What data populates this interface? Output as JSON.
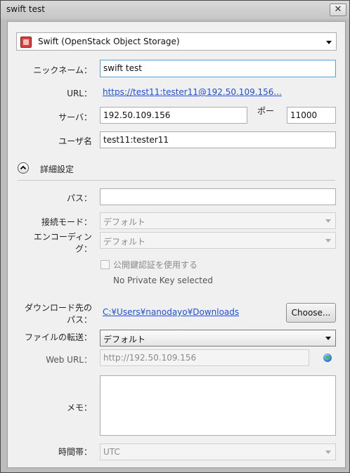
{
  "window": {
    "title": "swift test",
    "close_symbol": "✕"
  },
  "service": {
    "selected": "Swift (OpenStack Object Storage)"
  },
  "form": {
    "nickname_label": "ニックネーム：",
    "nickname_value": "swift test",
    "url_label": "URL：",
    "url_value": "https://test11:tester11@192.50.109.156...",
    "server_label": "サーバ：",
    "server_value": "192.50.109.156",
    "port_label": "ポー",
    "port_value": "11000",
    "user_label": "ユーザ名",
    "user_value": "test11:tester11"
  },
  "advanced": {
    "toggle_label": "詳細設定",
    "path_label": "パス：",
    "path_value": "",
    "mode_label": "接続モード：",
    "mode_value": "デフォルト",
    "encoding_label_1": "エンコーディン",
    "encoding_label_2": "グ：",
    "encoding_value": "デフォルト",
    "pubkey_label": "公開鍵認証を使用する",
    "private_key_status": "No Private Key selected",
    "download_label_1": "ダウンロード先の",
    "download_label_2": "パス：",
    "download_path": "C:¥Users¥nanodayo¥Downloads",
    "choose_button": "Choose...",
    "transfer_label": "ファイルの転送：",
    "transfer_value": "デフォルト",
    "weburl_label": "Web URL：",
    "weburl_value": "http://192.50.109.156",
    "memo_label": "メモ：",
    "memo_value": "",
    "timezone_label": "時間帯：",
    "timezone_value": "UTC"
  }
}
